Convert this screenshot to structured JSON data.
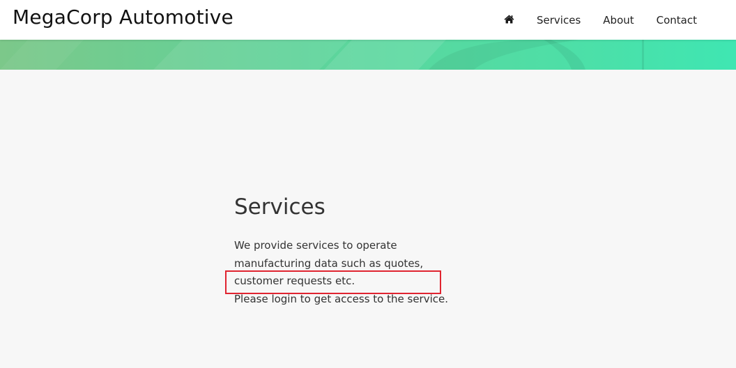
{
  "header": {
    "brand": "MegaCorp Automotive",
    "nav": [
      {
        "icon": "home-icon"
      },
      {
        "label": "Services"
      },
      {
        "label": "About"
      },
      {
        "label": "Contact"
      }
    ]
  },
  "main": {
    "title": "Services",
    "description_line1": "We provide services to operate manufacturing data such as quotes, customer requests etc.",
    "description_line2": "Please login to get access to the service."
  },
  "colors": {
    "banner_start": "#7cc88a",
    "banner_end": "#3fe6b2",
    "highlight": "#e02430",
    "background": "#f7f7f7"
  }
}
